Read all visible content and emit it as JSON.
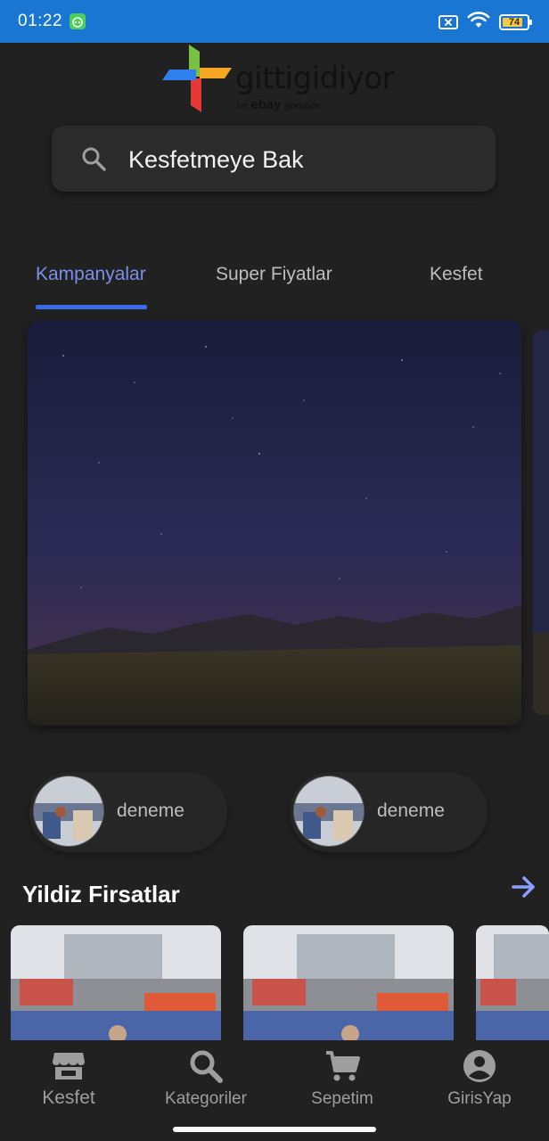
{
  "status_bar": {
    "time": "01:22",
    "battery_level": "74",
    "icons": [
      "android-debug-icon",
      "sim-off-icon",
      "wifi-icon",
      "battery-icon"
    ],
    "background_color": "#1976d2"
  },
  "logo": {
    "brand": "gittigidiyor",
    "tagline_prefix": "bir",
    "tagline_brand": "ebay",
    "tagline_suffix": "şirketidir"
  },
  "search": {
    "placeholder": "Kesfetmeye Bak",
    "icon": "search-icon"
  },
  "tabs": [
    {
      "label": "Kampanyalar",
      "active": true
    },
    {
      "label": "Super Fiyatlar",
      "active": false
    },
    {
      "label": "Kesfet",
      "active": false
    }
  ],
  "hero": {
    "image": "night-sky-landscape"
  },
  "chips": [
    {
      "label": "deneme"
    },
    {
      "label": "deneme"
    }
  ],
  "featured": {
    "title": "Yildiz Firsatlar",
    "arrow_icon": "arrow-right-icon"
  },
  "bottom_nav": [
    {
      "label": "Kesfet",
      "icon": "store-icon",
      "active": true
    },
    {
      "label": "Kategoriler",
      "icon": "search-icon",
      "active": false
    },
    {
      "label": "Sepetim",
      "icon": "cart-icon",
      "active": false
    },
    {
      "label": "GirisYap",
      "icon": "account-icon",
      "active": false
    }
  ],
  "colors": {
    "background": "#212121",
    "accent": "#3b6ae8",
    "active_tab_text": "#7b8fe8",
    "arrow": "#8c9eff"
  }
}
